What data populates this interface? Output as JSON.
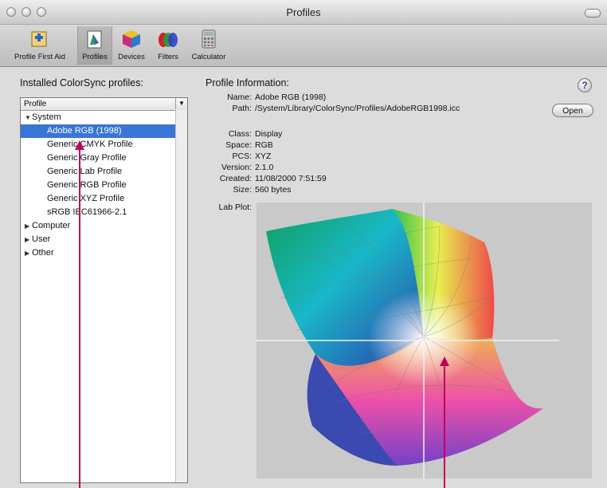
{
  "window": {
    "title": "Profiles"
  },
  "toolbar": {
    "items": [
      {
        "label": "Profile First Aid",
        "icon": "profile-first-aid-icon"
      },
      {
        "label": "Profiles",
        "icon": "profiles-icon",
        "selected": true
      },
      {
        "label": "Devices",
        "icon": "devices-icon"
      },
      {
        "label": "Filters",
        "icon": "filters-icon"
      },
      {
        "label": "Calculator",
        "icon": "calculator-icon"
      }
    ]
  },
  "left": {
    "heading": "Installed ColorSync profiles:",
    "column_header": "Profile",
    "tree": [
      {
        "label": "System",
        "expanded": true
      },
      {
        "label": "Adobe RGB (1998)",
        "selected": true
      },
      {
        "label": "Generic CMYK Profile"
      },
      {
        "label": "Generic Gray Profile"
      },
      {
        "label": "Generic Lab Profile"
      },
      {
        "label": "Generic RGB Profile"
      },
      {
        "label": "Generic XYZ Profile"
      },
      {
        "label": "sRGB IEC61966-2.1"
      },
      {
        "label": "Computer",
        "expanded": false
      },
      {
        "label": "User",
        "expanded": false
      },
      {
        "label": "Other",
        "expanded": false
      }
    ]
  },
  "info": {
    "heading": "Profile Information:",
    "fields": [
      {
        "key": "Name:",
        "value": "Adobe RGB (1998)"
      },
      {
        "key": "Path:",
        "value": "/System/Library/ColorSync/Profiles/AdobeRGB1998.icc"
      },
      {
        "key": "Class:",
        "value": "Display"
      },
      {
        "key": "Space:",
        "value": "RGB"
      },
      {
        "key": "PCS:",
        "value": "XYZ"
      },
      {
        "key": "Version:",
        "value": "2.1.0"
      },
      {
        "key": "Created:",
        "value": "11/08/2000 7:51:59"
      },
      {
        "key": "Size:",
        "value": "560 bytes"
      }
    ],
    "open_label": "Open",
    "help_label": "?",
    "plot_label": "Lab Plot:",
    "plot_toggle": "▼"
  },
  "colors": {
    "selection": "#3875d7",
    "callout": "#c0005a"
  }
}
